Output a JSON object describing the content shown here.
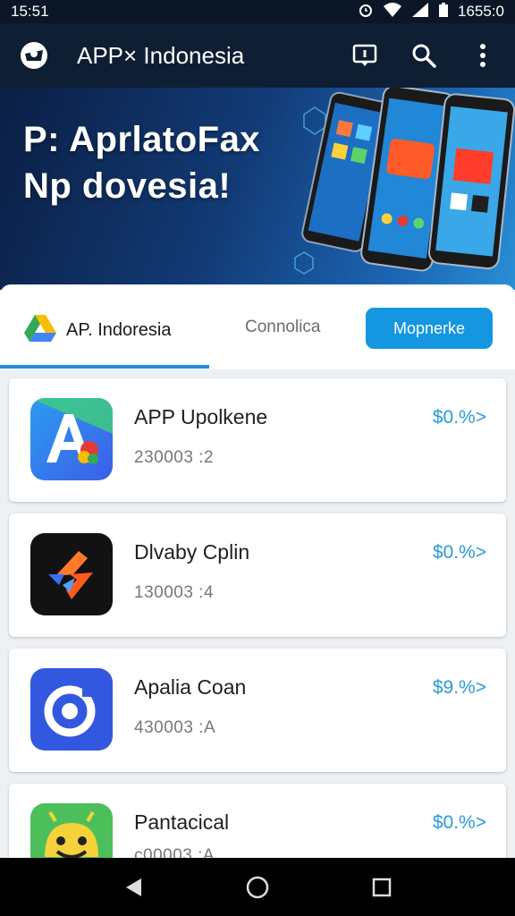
{
  "status_bar": {
    "time": "15:51",
    "right_text": "1655:0"
  },
  "app_bar": {
    "title": "APP× Indonesia",
    "icons": [
      "app-logo",
      "message-icon",
      "search-icon",
      "more-vert-icon"
    ]
  },
  "banner": {
    "line1": "P: AprlatoFax",
    "line2": "Np dovesia!"
  },
  "tabs": {
    "brand_label": "AP. Indoresia",
    "second_tab": "Connolica",
    "button_label": "Mopnerke"
  },
  "apps": [
    {
      "name": "APP Upolkene",
      "subtitle": "230003 :2",
      "price": "$0.%>",
      "icon": "a-letter-icon"
    },
    {
      "name": "Dlvaby Cplin",
      "subtitle": "130003 :4",
      "price": "$0.%>",
      "icon": "bolt-icon"
    },
    {
      "name": "Apalia Coan",
      "subtitle": "430003 :A",
      "price": "$9.%>",
      "icon": "ring-icon"
    },
    {
      "name": "Pantacical",
      "subtitle": "c00003 :A",
      "price": "$0.%>",
      "icon": "android-icon"
    }
  ],
  "colors": {
    "accent": "#1596e0",
    "app_bar": "#0e1e33",
    "price": "#2a9bd6"
  }
}
